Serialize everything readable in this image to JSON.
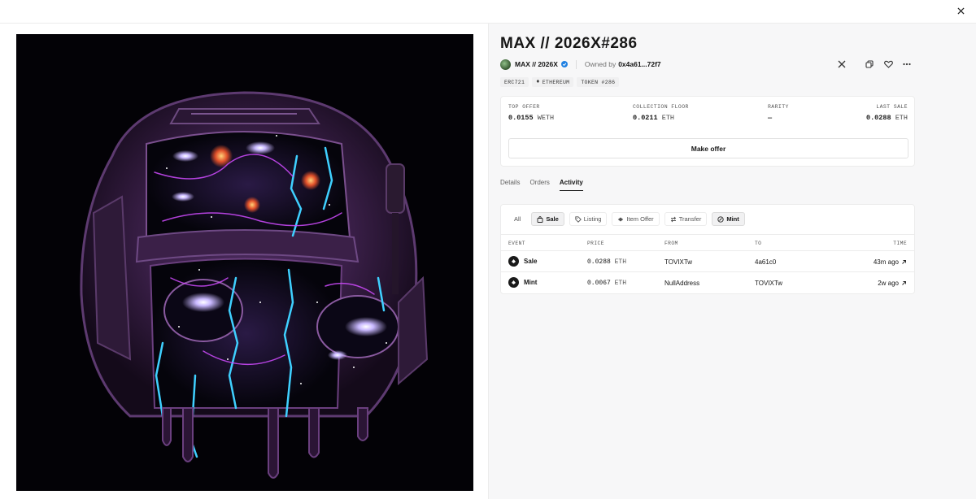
{
  "window": {
    "close_icon": "close-icon"
  },
  "item": {
    "title": "MAX // 2026X#286",
    "collection_name": "MAX // 2026X",
    "owned_by_label": "Owned by",
    "owner": "0x4a61...72f7"
  },
  "chips": {
    "standard": "ERC721",
    "chain": "ETHEREUM",
    "token": "TOKEN #286"
  },
  "stats": {
    "top_offer_label": "TOP OFFER",
    "top_offer_value": "0.0155",
    "top_offer_unit": "WETH",
    "floor_label": "COLLECTION FLOOR",
    "floor_value": "0.0211",
    "floor_unit": "ETH",
    "rarity_label": "RARITY",
    "rarity_value": "—",
    "last_sale_label": "LAST SALE",
    "last_sale_value": "0.0288",
    "last_sale_unit": "ETH",
    "make_offer": "Make offer"
  },
  "tabs": [
    "Details",
    "Orders",
    "Activity"
  ],
  "filters": [
    "All",
    "Sale",
    "Listing",
    "Item Offer",
    "Transfer",
    "Mint"
  ],
  "table": {
    "headers": [
      "EVENT",
      "PRICE",
      "FROM",
      "TO",
      "TIME"
    ],
    "rows": [
      {
        "event": "Sale",
        "price": "0.0288",
        "unit": "ETH",
        "from": "TOVIXTw",
        "to": "4a61c0",
        "time": "43m ago"
      },
      {
        "event": "Mint",
        "price": "0.0067",
        "unit": "ETH",
        "from": "NullAddress",
        "to": "TOVIXTw",
        "time": "2w ago"
      }
    ]
  },
  "colors": {
    "accent_verified": "#2081e2",
    "panel_bg": "#f7f7f8",
    "art_bg": "#030206"
  }
}
